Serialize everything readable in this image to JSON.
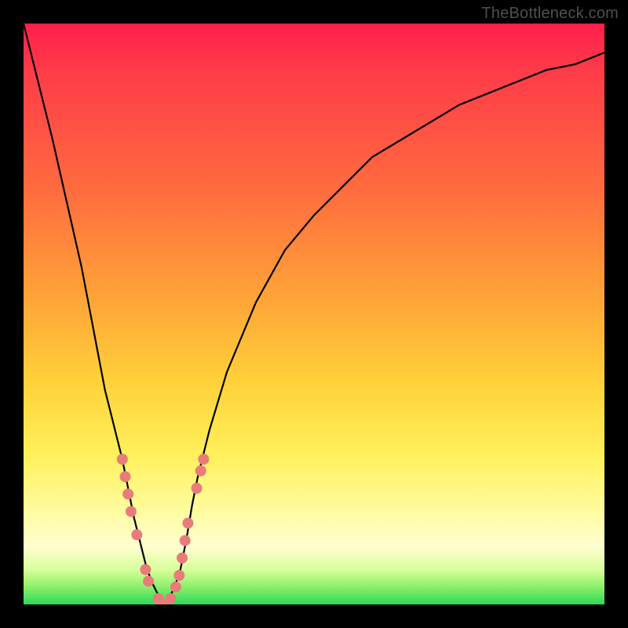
{
  "watermark": "TheBottleneck.com",
  "colors": {
    "frame": "#000000",
    "curve": "#000000",
    "markers": "#e87c7a",
    "gradient_top": "#ff1f4a",
    "gradient_bottom": "#2fd85a"
  },
  "chart_data": {
    "type": "line",
    "title": "",
    "xlabel": "",
    "ylabel": "",
    "xlim": [
      0,
      100
    ],
    "ylim": [
      0,
      100
    ],
    "grid": false,
    "legend": false,
    "notes": "V-shaped bottleneck curve over red-to-green vertical gradient. Lower y = better (green). Curve minimum near x≈24. Pink markers cluster around the trough.",
    "series": [
      {
        "name": "bottleneck-curve",
        "x": [
          0,
          5,
          10,
          14,
          17,
          19,
          21,
          22,
          23,
          24,
          25,
          26,
          27,
          28,
          29,
          30,
          32,
          35,
          40,
          45,
          50,
          55,
          60,
          65,
          70,
          75,
          80,
          85,
          90,
          95,
          100
        ],
        "y": [
          100,
          80,
          58,
          37,
          25,
          15,
          7,
          4,
          2,
          0,
          1,
          3,
          6,
          11,
          17,
          22,
          30,
          40,
          52,
          61,
          67,
          72,
          77,
          80,
          83,
          86,
          88,
          90,
          92,
          93,
          95
        ]
      }
    ],
    "markers": [
      {
        "x": 17.0,
        "y": 25
      },
      {
        "x": 17.5,
        "y": 22
      },
      {
        "x": 18.0,
        "y": 19
      },
      {
        "x": 18.5,
        "y": 16
      },
      {
        "x": 19.5,
        "y": 12
      },
      {
        "x": 21.0,
        "y": 6
      },
      {
        "x": 21.5,
        "y": 4
      },
      {
        "x": 23.2,
        "y": 1
      },
      {
        "x": 24.0,
        "y": 0
      },
      {
        "x": 25.3,
        "y": 1
      },
      {
        "x": 26.2,
        "y": 3
      },
      {
        "x": 26.8,
        "y": 5
      },
      {
        "x": 27.3,
        "y": 8
      },
      {
        "x": 27.8,
        "y": 11
      },
      {
        "x": 28.3,
        "y": 14
      },
      {
        "x": 29.8,
        "y": 20
      },
      {
        "x": 30.5,
        "y": 23
      },
      {
        "x": 31.0,
        "y": 25
      }
    ]
  }
}
